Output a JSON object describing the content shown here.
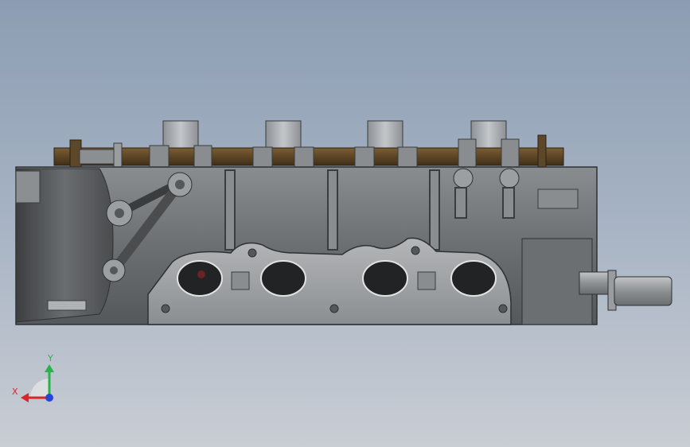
{
  "viewport": {
    "background_top": "#8c9db3",
    "background_bottom": "#c9cdd4",
    "part_color": "#6f7275",
    "camshaft_color": "#5a4325"
  },
  "model": {
    "name": "cylinder-head",
    "view": "front"
  },
  "triad": {
    "x_label": "X",
    "y_label": "Y",
    "x_color": "#d8262b",
    "y_color": "#28b34a",
    "z_color": "#2346d8"
  }
}
